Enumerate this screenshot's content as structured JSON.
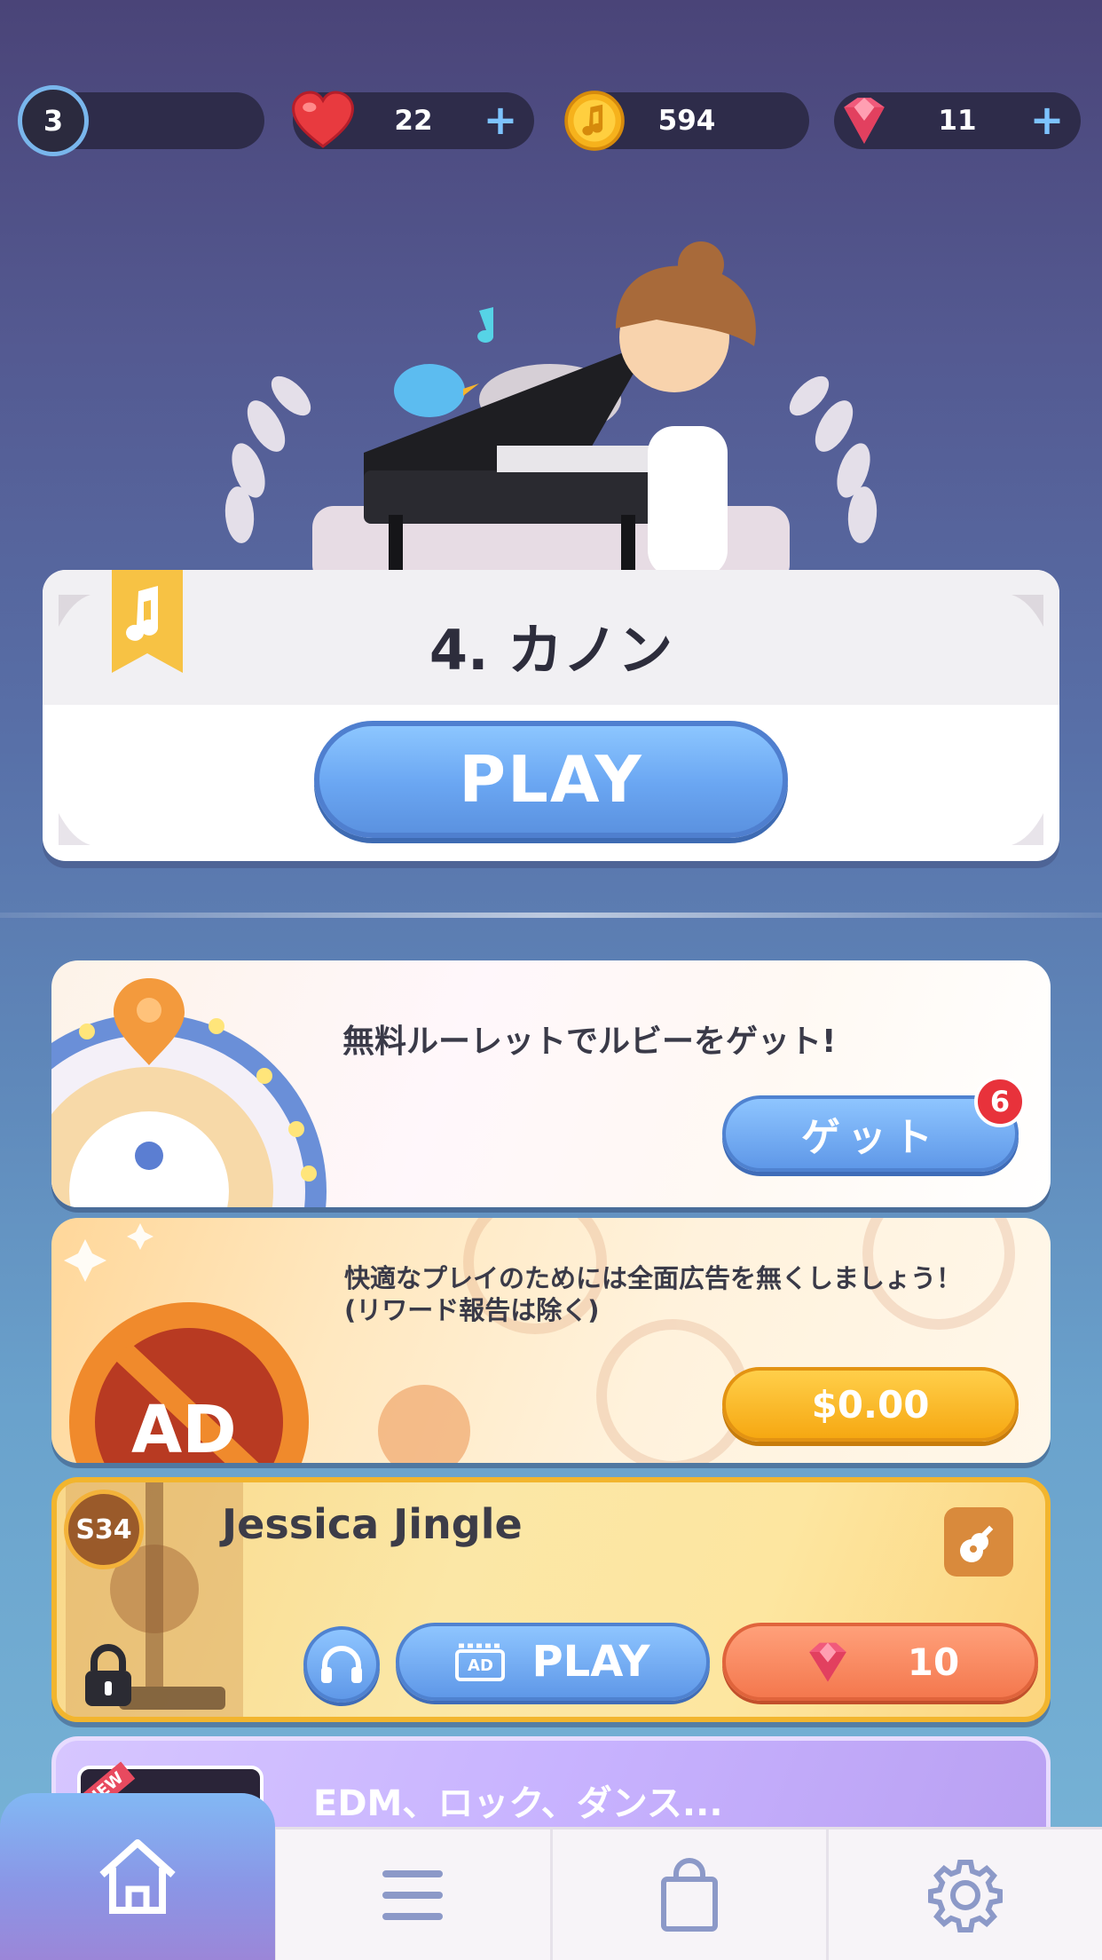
{
  "stats": {
    "level": "3",
    "hearts": "22",
    "coins": "594",
    "gems": "11",
    "heart_icon": "heart-icon",
    "coin_icon": "coin-icon",
    "gem_icon": "ruby-icon"
  },
  "song_card": {
    "title": "4. カノン",
    "play_label": "PLAY"
  },
  "roulette": {
    "text": "無料ルーレットでルビーをゲット!",
    "button_label": "ゲット",
    "badge_count": "6"
  },
  "remove_ads": {
    "line1": "快適なプレイのためには全面広告を無くしましょう！",
    "line2": "(リワード報告は除く)",
    "price_label": "$0.00",
    "ad_text": "AD"
  },
  "song_item": {
    "level_badge": "S34",
    "name": "Jessica Jingle",
    "ad_label": "AD",
    "play_label": "PLAY",
    "gem_price": "10"
  },
  "edm_card": {
    "text": "EDM、ロック、ダンス...",
    "badge": "NEW"
  },
  "nav": {
    "tabs": [
      "home-icon",
      "menu-icon",
      "shop-bag-icon",
      "gear-icon"
    ]
  },
  "colors": {
    "accent_blue": "#6aa6f2",
    "gold": "#f6a812",
    "coral": "#f4784e",
    "badge_red": "#e8323b"
  }
}
